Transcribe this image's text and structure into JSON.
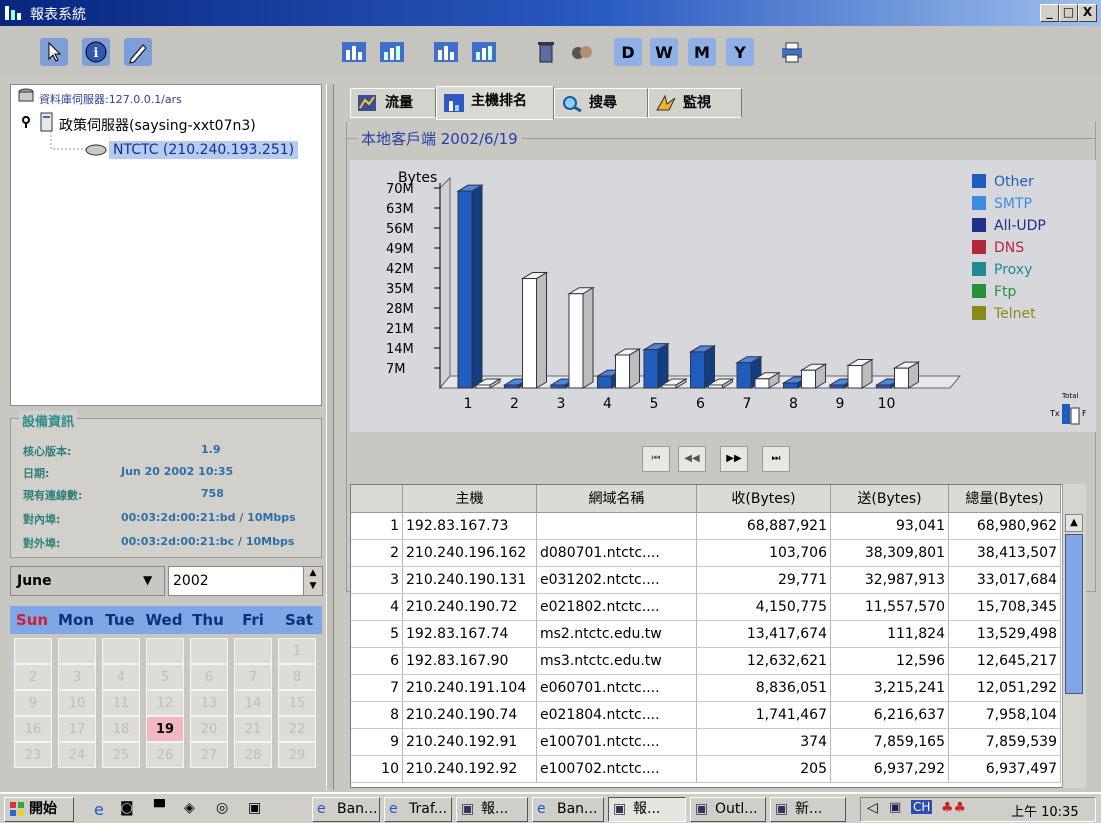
{
  "window": {
    "title": "報表系統",
    "controls": [
      "_",
      "□",
      "X"
    ]
  },
  "toolbar": {
    "left_buttons": [
      "pointer-icon",
      "info-icon",
      "edit-icon"
    ],
    "right_buttons": [
      "report-bars-icon",
      "report-bars-icon",
      "report-bars-icon",
      "report-bars-icon",
      "trash-icon",
      "user-group-icon",
      "D",
      "W",
      "M",
      "Y",
      "print-icon"
    ]
  },
  "tree": {
    "server": "資料庫伺服器:127.0.0.1/ars",
    "policy_server": "政策伺服器(saysing-xxt07n3)",
    "node": "NTCTC (210.240.193.251)"
  },
  "device_info": {
    "title": "設備資訊",
    "rows": [
      {
        "label": "核心版本:",
        "value": "1.9"
      },
      {
        "label": "日期:",
        "value": "Jun 20 2002 10:35"
      },
      {
        "label": "現有連線數:",
        "value": "758"
      },
      {
        "label": "對內埠:",
        "value": "00:03:2d:00:21:bd / 10Mbps"
      },
      {
        "label": "對外埠:",
        "value": "00:03:2d:00:21:bc / 10Mbps"
      }
    ]
  },
  "calendar": {
    "month": "June",
    "year": "2002",
    "weekdays": [
      "Sun",
      "Mon",
      "Tue",
      "Wed",
      "Thu",
      "Fri",
      "Sat"
    ],
    "rows": [
      [
        "",
        "",
        "",
        "",
        "",
        "",
        "1"
      ],
      [
        "2",
        "3",
        "4",
        "5",
        "6",
        "7",
        "8"
      ],
      [
        "9",
        "10",
        "11",
        "12",
        "13",
        "14",
        "15"
      ],
      [
        "16",
        "17",
        "18",
        "19",
        "20",
        "21",
        "22"
      ],
      [
        "23",
        "24",
        "25",
        "26",
        "27",
        "28",
        "29"
      ]
    ],
    "selected": "19"
  },
  "tabs": [
    "流量",
    "主機排名",
    "搜尋",
    "監視"
  ],
  "active_tab": "主機排名",
  "chart_title": "本地客戶端 2002/6/19",
  "chart_data": {
    "type": "bar",
    "title": "",
    "ylabel": "Bytes",
    "yticks": [
      "7M",
      "14M",
      "21M",
      "28M",
      "35M",
      "42M",
      "49M",
      "56M",
      "63M",
      "70M"
    ],
    "ylim": [
      0,
      70
    ],
    "categories": [
      "1",
      "2",
      "3",
      "4",
      "5",
      "6",
      "7",
      "8",
      "9",
      "10"
    ],
    "legend": [
      "Other",
      "SMTP",
      "All-UDP",
      "DNS",
      "Proxy",
      "Ftp",
      "Telnet"
    ],
    "legend_colors": [
      "#1f5ebf",
      "#3d8ce0",
      "#23308a",
      "#b1283c",
      "#1f8a8f",
      "#2a8f3a",
      "#8a8a1a"
    ],
    "series": [
      {
        "name": "收",
        "values": [
          68.9,
          0.1,
          0.03,
          4.15,
          13.42,
          12.63,
          8.84,
          1.74,
          0.0004,
          0.0002
        ]
      },
      {
        "name": "送",
        "values": [
          0.09,
          38.31,
          32.99,
          11.56,
          0.11,
          0.01,
          3.22,
          6.22,
          7.86,
          6.94
        ]
      },
      {
        "name": "總量",
        "values": [
          68.98,
          38.41,
          33.02,
          15.71,
          13.53,
          12.65,
          12.05,
          7.96,
          7.86,
          6.94
        ]
      }
    ],
    "total_label": "Total",
    "tx_label": "Tx",
    "f_label": "F"
  },
  "table": {
    "headers": [
      "",
      "主機",
      "網域名稱",
      "收(Bytes)",
      "送(Bytes)",
      "總量(Bytes)"
    ],
    "rows": [
      [
        "1",
        "192.83.167.73",
        "",
        "68,887,921",
        "93,041",
        "68,980,962"
      ],
      [
        "2",
        "210.240.196.162",
        "d080701.ntctc....",
        "103,706",
        "38,309,801",
        "38,413,507"
      ],
      [
        "3",
        "210.240.190.131",
        "e031202.ntctc....",
        "29,771",
        "32,987,913",
        "33,017,684"
      ],
      [
        "4",
        "210.240.190.72",
        "e021802.ntctc....",
        "4,150,775",
        "11,557,570",
        "15,708,345"
      ],
      [
        "5",
        "192.83.167.74",
        "ms2.ntctc.edu.tw",
        "13,417,674",
        "111,824",
        "13,529,498"
      ],
      [
        "6",
        "192.83.167.90",
        "ms3.ntctc.edu.tw",
        "12,632,621",
        "12,596",
        "12,645,217"
      ],
      [
        "7",
        "210.240.191.104",
        "e060701.ntctc....",
        "8,836,051",
        "3,215,241",
        "12,051,292"
      ],
      [
        "8",
        "210.240.190.74",
        "e021804.ntctc....",
        "1,741,467",
        "6,216,637",
        "7,958,104"
      ],
      [
        "9",
        "210.240.192.91",
        "e100701.ntctc....",
        "374",
        "7,859,165",
        "7,859,539"
      ],
      [
        "10",
        "210.240.192.92",
        "e100702.ntctc....",
        "205",
        "6,937,292",
        "6,937,497"
      ]
    ]
  },
  "taskbar": {
    "start": "開始",
    "tasks": [
      "Ban...",
      "Traf...",
      "報...",
      "Ban...",
      "報...",
      "Outl...",
      "新..."
    ],
    "clock": "上午 10:35"
  }
}
